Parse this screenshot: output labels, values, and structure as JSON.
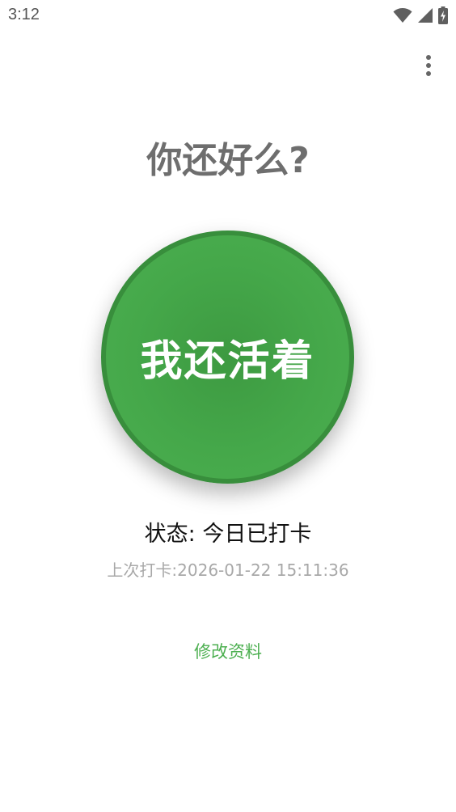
{
  "status_bar": {
    "time": "3:12",
    "icons": [
      "wifi-icon",
      "cell-signal-icon",
      "battery-charging-icon"
    ]
  },
  "toolbar": {
    "menu_icon": "more-vertical-icon"
  },
  "main": {
    "headline": "你还好么?",
    "alive_button_label": "我还活着",
    "status_text": "状态: 今日已打卡",
    "last_checkin_text": "上次打卡:2026-01-22 15:11:36",
    "edit_profile_label": "修改资料"
  },
  "colors": {
    "primary_green": "#4caf50",
    "border_green": "#388e3c",
    "headline_gray": "#6e6e6e",
    "subtext_gray": "#a8a8a8"
  }
}
